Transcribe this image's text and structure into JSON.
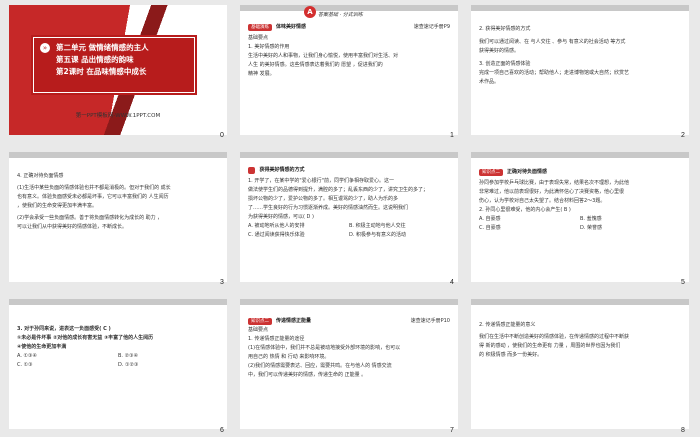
{
  "slide1": {
    "l1": "第二单元  做情绪情感的主人",
    "l2": "第五课  品出情感的韵味",
    "l3": "第2课时  在品味情感中成长",
    "foot": "第一PPT模板网-WWW.1PPT.COM"
  },
  "slide2": {
    "banner": "答案基础 · 分式训练",
    "tag": "基础演练",
    "title": "体味美好情感",
    "ref": "速查速记手册P9",
    "h1": "基础要点",
    "h2": "1. 美好情感的作用",
    "p1": "生活中美好的人和事物，让我们身心愉悦，使用丰富我们对生活、对",
    "p2": "人生 的美好情感。这些情感表达着我们的 愿望 ，促进我们的",
    "p3": "精神 发展。",
    "a1": "人生",
    "a2": "愿望",
    "a3": "精神"
  },
  "slide3": {
    "l1": "2. 获得美好情感的方式",
    "l2": "我们可以通过阅读、在 与人交往 、参与 有意义的社会活动 等方式",
    "l3": "获得美好的情感。",
    "l4": "3. 创造正面的情感体验",
    "l5": "完成一项自己喜欢的活动；帮助他人；走进博物馆或大自然；欣赏艺",
    "l6": "术作品。",
    "a1": "与人交往",
    "a2": "有意义的社会活动"
  },
  "slide4": {
    "l1": "4. 正确对待负面情感",
    "l2": "(1)生活中某些负面的情感体验也并不都是消极的。但对于我们的 成长",
    "l3": "也有意义。体验负面感受未必都是坏事，它可以丰富我们的 人生阅历",
    "l4": "，使我们的生命变得更加丰满丰富。",
    "l5": "(2)学会承受一些负面情感。善于将负面情感转化为成长的 助力 ，",
    "l6": "可以让我们从中获得美好的情感体验，不断成长。",
    "a1": "成长",
    "a2": "人生阅历",
    "a3": "助力"
  },
  "slide5": {
    "title": "获得美好情感的方式",
    "q1": "1. 开学了，在某中学的\"爱心银行\"前，同学们争相存取爱心。这一",
    "q2": "做法使学生们的品德得到提升，满腔的多了；乱丢东西的少了，讲究卫生的多了；",
    "q3": "损坏公物的少了，爱护公物的多了。相互谩骂的少了，助人为乐的多",
    "q4": "了……学生良好的行为习惯逐渐养成。美好的情感油然而生。这说明我们",
    "q5": "为获得美好的情感，可以( D )",
    "oA": "A. 被动地听从他人的安排",
    "oB": "B. 积极主动地与他人交往",
    "oC": "C. 通过阅读获得快乐体验",
    "oD": "D. 积极参与有意义的活动",
    "ans": "D"
  },
  "slide6": {
    "tag": "知识点二",
    "title": "正确对待负面情感",
    "p1": "孙同参加学校乒乓球比赛，由于表现失常，结果名次不理想，为此他",
    "p2": "非常难过，他以前表现很好，为此满怀信心了决赛资格，他心里很",
    "p3": "伤心，认为学校对自己太失望了。结合材料回答2～3题。",
    "q": "2. 孙同心里很难受，他的内心会产生( B )",
    "oA": "A. 自豪感",
    "oB": "B. 羞愧感",
    "oC": "C. 自豪感",
    "oD": "D. 荣誉感",
    "ans": "B"
  },
  "slide7": {
    "q": "3. 对于孙同来说，进表这一负面感受( C )",
    "i1": "①未必是件坏事  ②对他的成长有害无益  ③丰富了他的人生阅历",
    "i2": "④使他的生命更加丰满",
    "oA": "A. ①③④",
    "oB": "B. ②③④",
    "oC": "C. ①③",
    "oD": "D. ①②③",
    "ans": "C"
  },
  "slide8": {
    "tag": "知识点二",
    "title": "传递情感正能量",
    "ref": "速查速记手册P10",
    "h1": "基础要点",
    "h2": "1. 传递情感正能量的途径",
    "p1": "(1)在情感体验中，我们并不总是被动地接受外部环境的影响，也可以",
    "p2": "用自己的 热情 和 行动 来影响环境。",
    "p3": "(2)我们的情感需要表达、回应，需要共鸣。在与他人的 情感交流",
    "p4": "中，我们可以传递美好的情感，传递生命的 正能量 。",
    "a1": "热情",
    "a2": "行动",
    "a3": "情感交流",
    "a4": "正能量"
  },
  "slide9": {
    "l1": "2. 传递情感正能量的意义",
    "l2": "我们在生活中不断创造美好的情感体验，在传递情感的过程中不断获",
    "l3": "得 新的感动 ，使我们的生命更有 力量 ，周围的世界也因为我们",
    "l4": "的 积极情感 而多一份美好。",
    "a1": "新的感动",
    "a2": "力量",
    "a3": "积极情感"
  },
  "page_numbers": [
    "0",
    "1",
    "2",
    "3",
    "4",
    "5",
    "6",
    "7",
    "8"
  ]
}
